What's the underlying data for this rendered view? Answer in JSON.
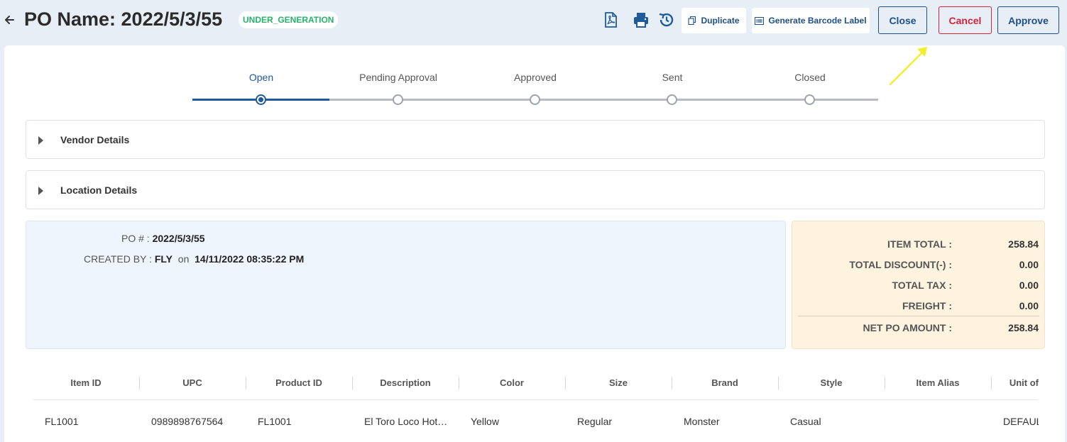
{
  "header": {
    "title": "PO Name: 2022/5/3/55",
    "status": "UNDER_GENERATION",
    "duplicate_label": "Duplicate",
    "barcode_label": "Generate Barcode Label",
    "close_label": "Close",
    "cancel_label": "Cancel",
    "approve_label": "Approve"
  },
  "stepper": {
    "steps": [
      "Open",
      "Pending Approval",
      "Approved",
      "Sent",
      "Closed"
    ],
    "active_step": "Open"
  },
  "sections": {
    "vendor": "Vendor Details",
    "location": "Location Details"
  },
  "po_info": {
    "po_label": "PO # :",
    "po_value": "2022/5/3/55",
    "created_by_label": "CREATED BY :",
    "created_by_value": "FLY",
    "on_label": "on",
    "created_at": "14/11/2022 08:35:22 PM"
  },
  "totals": {
    "item_total_label": "ITEM TOTAL :",
    "item_total": "258.84",
    "discount_label": "TOTAL DISCOUNT(-) :",
    "discount": "0.00",
    "tax_label": "TOTAL TAX :",
    "tax": "0.00",
    "freight_label": "FREIGHT :",
    "freight": "0.00",
    "net_label": "NET PO AMOUNT :",
    "net": "258.84"
  },
  "table": {
    "headers": [
      "Item ID",
      "UPC",
      "Product ID",
      "Description",
      "Color",
      "Size",
      "Brand",
      "Style",
      "Item Alias",
      "Unit of"
    ],
    "rows": [
      [
        "FL1001",
        "0989898767564",
        "FL1001",
        "El Toro Loco Hot…",
        "Yellow",
        "Regular",
        "Monster",
        "Casual",
        "",
        "DEFAUL"
      ]
    ]
  },
  "colors": {
    "primary": "#1e5b9a",
    "status_green": "#27b36b",
    "cancel_red": "#d4233a",
    "annotation_yellow": "#f2ef2a"
  }
}
